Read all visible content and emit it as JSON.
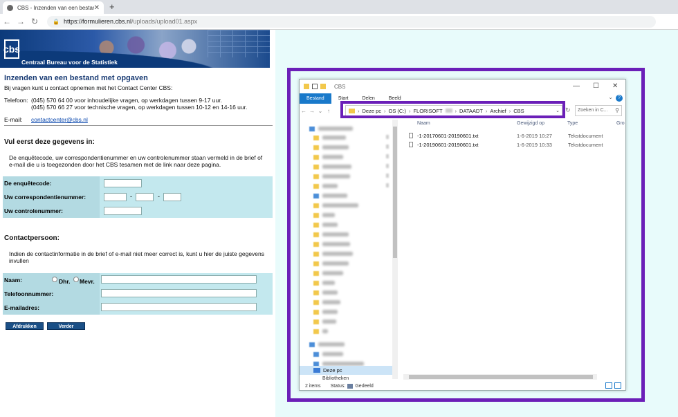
{
  "browser": {
    "tab_title": "CBS - Inzenden van een bestand",
    "tab_close": "✕",
    "new_tab": "+",
    "url_host": "https://formulieren.cbs.nl",
    "url_path": "/uploads/upload01.aspx"
  },
  "cbs": {
    "banner_name": "Centraal Bureau voor de Statistiek",
    "logo_text": "cbs",
    "title": "Inzenden van een bestand met opgaven",
    "intro": "Bij vragen kunt u contact opnemen met het Contact Center CBS:",
    "tel_label": "Telefoon:",
    "tel_line1": "(045) 570 64 00 voor inhoudelijke vragen, op werkdagen tussen 9-17 uur.",
    "tel_line2": "(045) 570 66 27 voor technische vragen, op werkdagen tussen 10-12 en 14-16 uur.",
    "mail_label": "E-mail:",
    "mail": "contactcenter@cbs.nl",
    "section1_title": "Vul eerst deze gegevens in:",
    "section1_text": "De enquêtecode, uw correspondentienummer en uw controlenummer staan vermeld in de brief of e-mail die u is toegezonden door het CBS tesamen met de link naar deze pagina.",
    "enquete_label": "De enquêtecode:",
    "corr_label": "Uw correspondentienummer:",
    "ctrl_label": "Uw controlenummer:",
    "dash": "-",
    "section2_title": "Contactpersoon:",
    "section2_text": "Indien de contactinformatie in de brief of e-mail niet meer correct is, kunt u hier de juiste gegevens invullen",
    "naam_label": "Naam:",
    "dhr": "Dhr.",
    "mevr": "Mevr.",
    "tel2_label": "Telefoonnummer:",
    "email_label": "E-mailadres:",
    "btn_print": "Afdrukken",
    "btn_next": "Verder"
  },
  "explorer": {
    "window_title": "CBS",
    "ribbon": [
      "Bestand",
      "Start",
      "Delen",
      "Beeld"
    ],
    "help": "?",
    "breadcrumbs": [
      "Deze pc",
      "OS (C:)",
      "FLORISOFT",
      "DATAADT",
      "Archief",
      "CBS"
    ],
    "search_placeholder": "Zoeken in C...",
    "columns": {
      "name": "Naam",
      "date": "Gewijzigd op",
      "type": "Type",
      "size": "Gro"
    },
    "files": [
      {
        "name": "-1-20170601-20190601.txt",
        "date": "1-6-2019 10:27",
        "type": "Tekstdocument"
      },
      {
        "name": "-1-20190601-20190601.txt",
        "date": "1-6-2019 10:33",
        "type": "Tekstdocument"
      }
    ],
    "nav_selected": "Deze pc",
    "nav_bib": "Bibliotheken",
    "status_items": "2 items",
    "status_label": "Status:",
    "status_shared": "Gedeeld"
  },
  "colors": {
    "highlight": "#6b1fb8",
    "accent": "#1979ca",
    "cbs_blue": "#1a4f86"
  }
}
